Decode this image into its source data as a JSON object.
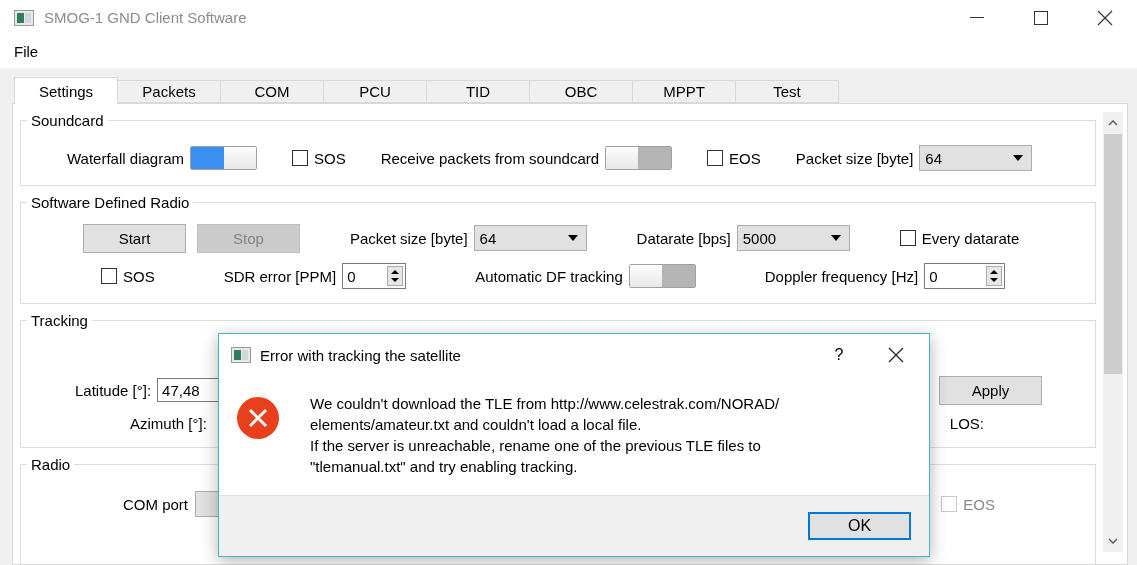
{
  "window": {
    "title": "SMOG-1 GND Client Software"
  },
  "menu": [
    "File"
  ],
  "tabs": [
    {
      "label": "Settings",
      "selected": true
    },
    {
      "label": "Packets",
      "selected": false
    },
    {
      "label": "COM",
      "selected": false
    },
    {
      "label": "PCU",
      "selected": false
    },
    {
      "label": "TID",
      "selected": false
    },
    {
      "label": "OBC",
      "selected": false
    },
    {
      "label": "MPPT",
      "selected": false
    },
    {
      "label": "Test",
      "selected": false
    }
  ],
  "soundcard": {
    "title": "Soundcard",
    "items": [
      {
        "kind": "toggle",
        "label": "Waterfall diagram",
        "on": true
      },
      {
        "kind": "checkbox",
        "label": "SOS",
        "checked": false
      },
      {
        "kind": "toggle",
        "label": "Receive packets from soundcard",
        "on": false
      },
      {
        "kind": "checkbox",
        "label": "EOS",
        "checked": false
      },
      {
        "kind": "combo",
        "label": "Packet size [byte]",
        "value": "64"
      }
    ]
  },
  "sdr": {
    "title": "Software Defined Radio",
    "rows": [
      [
        {
          "kind": "button",
          "label": "Start",
          "disabled": false
        },
        {
          "kind": "button",
          "label": "Stop",
          "disabled": true
        },
        {
          "kind": "combo",
          "label": "Packet size [byte]",
          "value": "64"
        },
        {
          "kind": "combo",
          "label": "Datarate [bps]",
          "value": "5000"
        },
        {
          "kind": "checkbox",
          "label": "Every datarate",
          "checked": false
        }
      ],
      [
        {
          "kind": "checkbox",
          "label": "SOS",
          "checked": false
        },
        {
          "kind": "spin",
          "label": "SDR error [PPM]",
          "value": "0"
        },
        {
          "kind": "toggle",
          "label": "Automatic DF tracking",
          "on": false
        },
        {
          "kind": "spin",
          "label": "Doppler frequency [Hz]",
          "value": "0"
        }
      ]
    ]
  },
  "tracking": {
    "title": "Tracking",
    "latitude": {
      "label": "Latitude [°]:",
      "value": "47,48"
    },
    "azimuth": {
      "label": "Azimuth [°]:"
    },
    "apply": "Apply",
    "los": "LOS:"
  },
  "radio": {
    "title": "Radio",
    "com_port": {
      "label": "COM port"
    },
    "eos": {
      "label": "EOS",
      "checked": false,
      "disabled": true
    }
  },
  "dialog": {
    "title": "Error with tracking the satellite",
    "help": "?",
    "message": "We couldn't download the TLE from http://www.celestrak.com/NORAD/\nelements/amateur.txt and couldn't load a local file.\nIf the server is unreachable, rename one of the previous TLE files to\n\"tlemanual.txt\" and try enabling tracking.",
    "ok": "OK"
  }
}
